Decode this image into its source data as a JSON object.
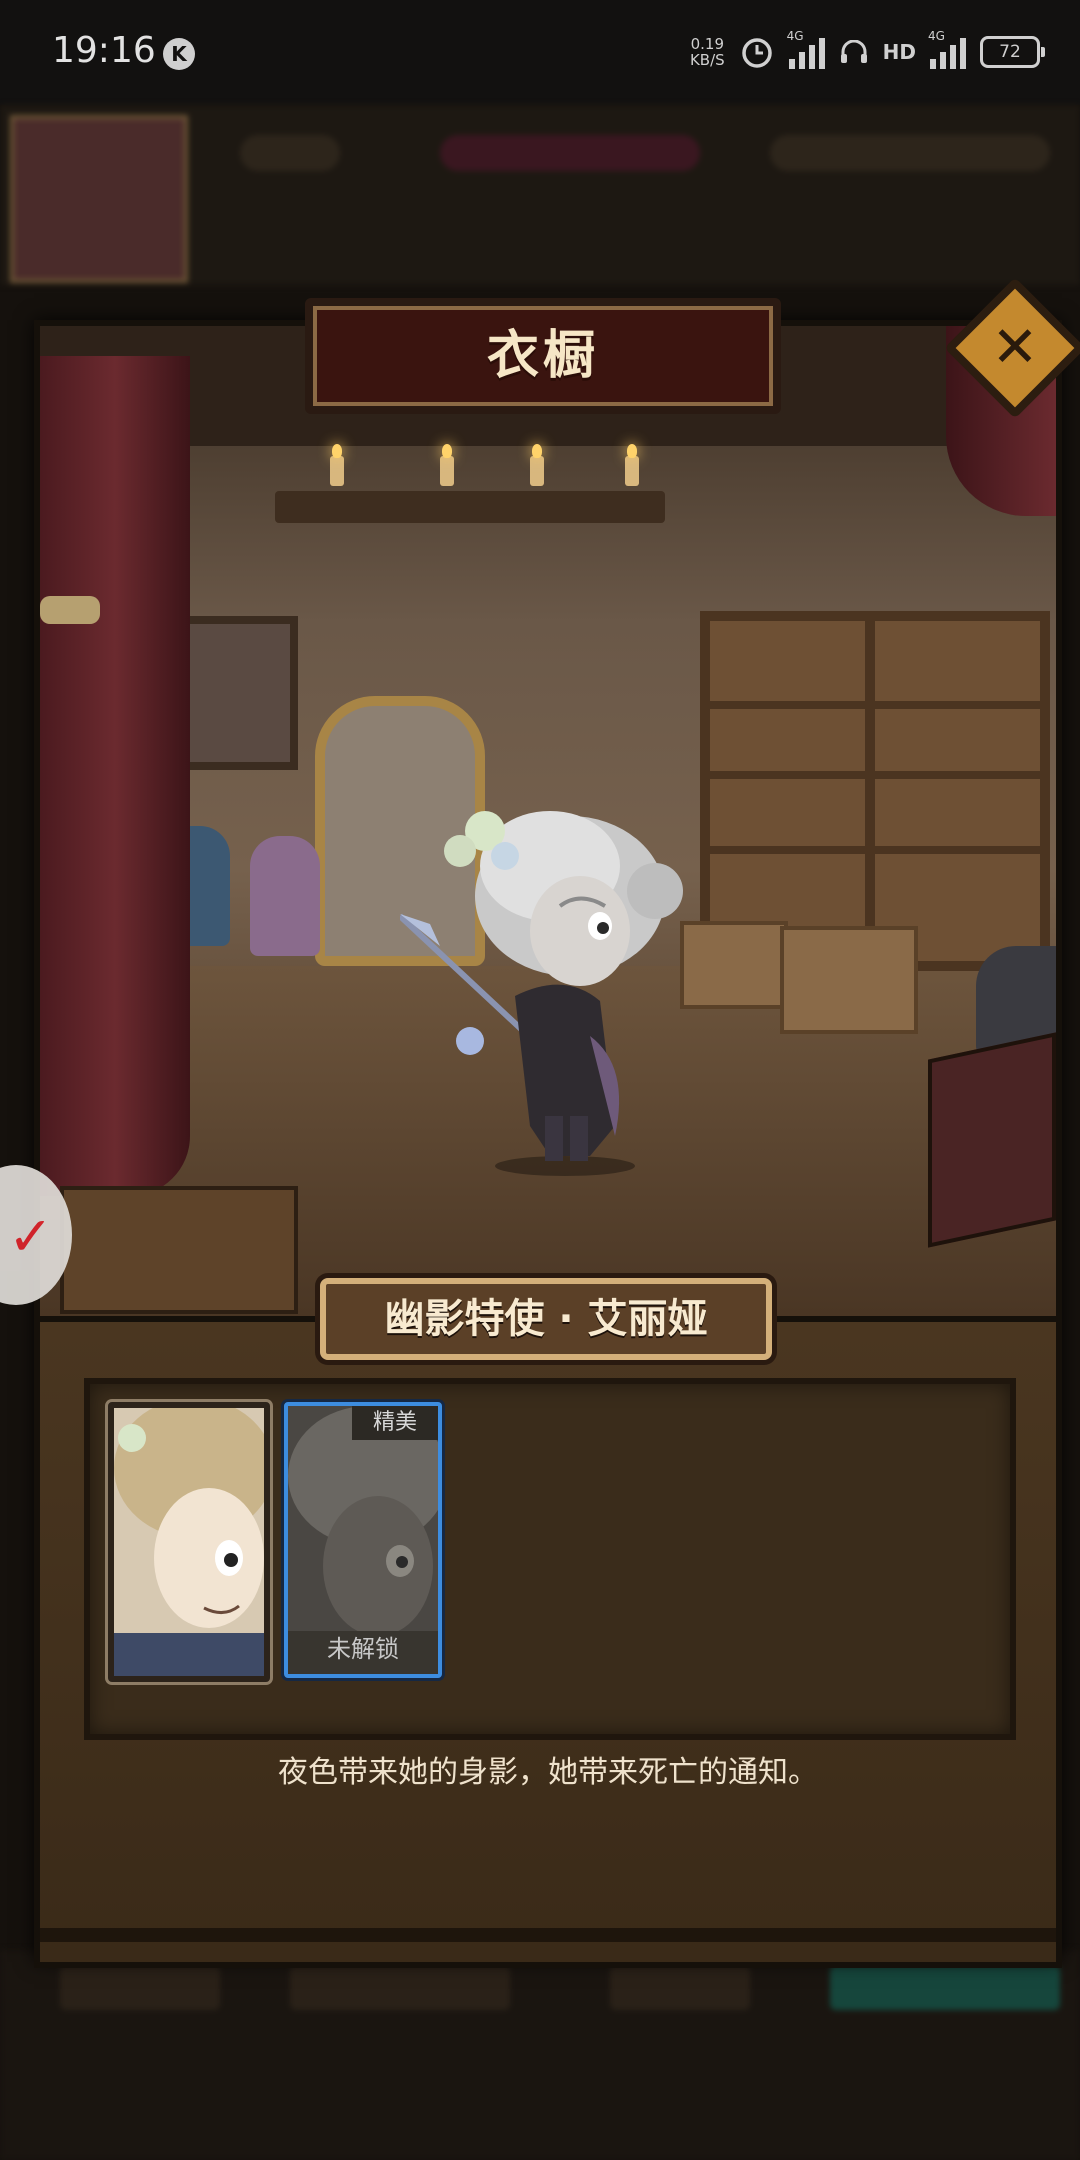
{
  "status_bar": {
    "time": "19:16",
    "notification_badge": "K",
    "net_speed_value": "0.19",
    "net_speed_unit": "KB/S",
    "sim1_tag": "4G",
    "hd_label": "HD",
    "sim2_tag": "4G",
    "battery_level": "72"
  },
  "dialog": {
    "title": "衣橱",
    "close_icon": "close-icon",
    "character_name": "幽影特使 · 艾丽娅",
    "skins": [
      {
        "name_icon": "portrait-default",
        "selected": false
      },
      {
        "tag": "精美",
        "status": "未解锁",
        "selected": true
      }
    ],
    "description": "夜色带来她的身影，她带来死亡的通知。"
  },
  "colors": {
    "accent_gold": "#c4892e",
    "selected_border": "#3d8de0",
    "banner_red": "#3a140f"
  }
}
